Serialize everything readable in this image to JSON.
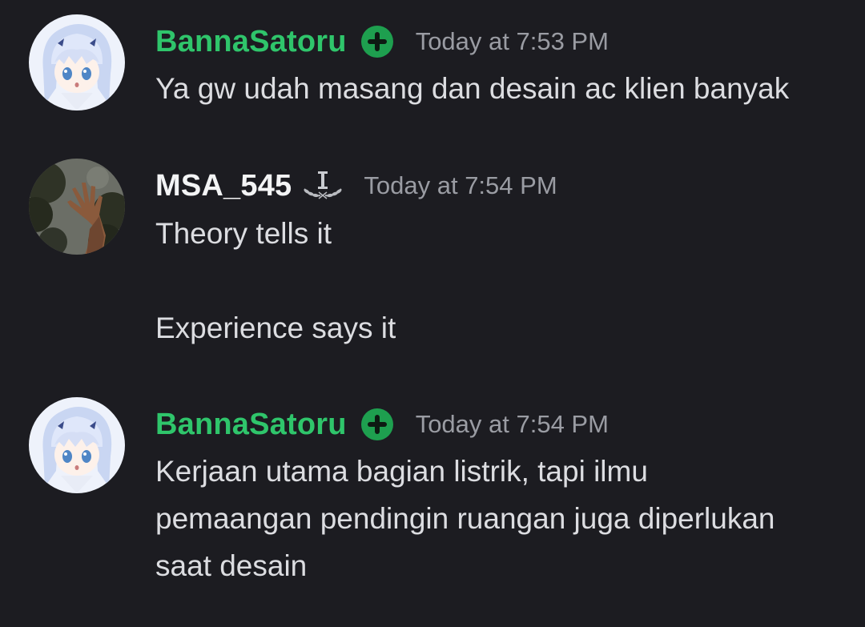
{
  "messages": [
    {
      "author": "BannaSatoru",
      "timestamp": "Today at 7:53 PM",
      "lines": [
        "Ya gw udah masang dan desain ac klien banyak"
      ]
    },
    {
      "author": "MSA_545",
      "timestamp": "Today at 7:54 PM",
      "lines": [
        "Theory tells it",
        "",
        "Experience says it"
      ]
    },
    {
      "author": "BannaSatoru",
      "timestamp": "Today at 7:54 PM",
      "lines": [
        "Kerjaan utama bagian listrik, tapi ilmu",
        "pemaangan pendingin ruangan juga diperlukan",
        "saat desain"
      ]
    }
  ],
  "icons": {
    "badge": "plus-circle-icon",
    "laurel": "laurel-icon"
  },
  "colors": {
    "background": "#1c1c21",
    "username_green": "#2fc56b",
    "username_white": "#f3f4f5",
    "timestamp": "#9a9ca3",
    "message_text": "#dcdde1",
    "badge_green": "#1e9f4f"
  }
}
